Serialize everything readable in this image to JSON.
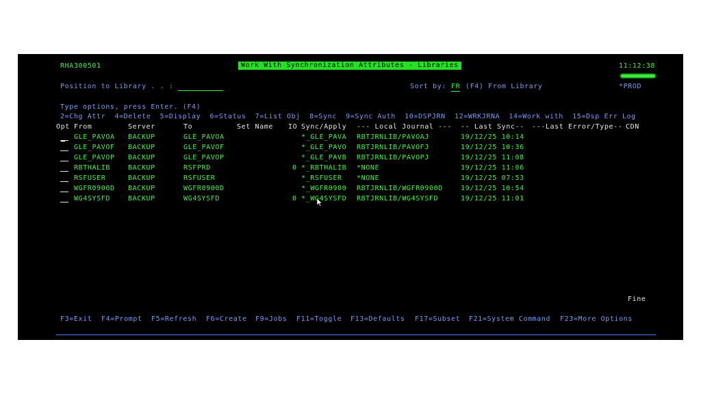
{
  "header": {
    "program": "RHA300501",
    "title": "Work With Synchronization Attributes - Libraries",
    "time": "11:12:38",
    "environment": "*PROD"
  },
  "position": {
    "label": "Position to Library . . :",
    "value": ""
  },
  "sort": {
    "label": "Sort by:",
    "value": "FR",
    "suffix": "(F4) From Library"
  },
  "options": {
    "instruction": "Type options, press Enter. (F4)",
    "line": "2=Chg Attr  4=Delete  5=Display  6=Status  7=List Obj  8=Sync  9=Sync Auth  10=DSPJRN  12=WRKJRNA  14=Work with  15=Dsp Err Log"
  },
  "table": {
    "columns": [
      "Opt",
      "From",
      "Server",
      "To",
      "Set Name",
      "IO",
      "Sync/Apply",
      "--- Local Journal ---",
      "-- Last Sync--",
      "---Last Error/Type--",
      "CDN"
    ],
    "rows": [
      {
        "opt": "",
        "from": "GLE_PAVOA",
        "server": "BACKUP",
        "to": "GLE_PAVOA",
        "set": "",
        "io": "",
        "sync": "*_GLE_PAVA",
        "journal": "RBTJRNLIB/PAVOAJ",
        "last_sync": "19/12/25 10:14"
      },
      {
        "opt": "",
        "from": "GLE_PAVOF",
        "server": "BACKUP",
        "to": "GLE_PAVOF",
        "set": "",
        "io": "",
        "sync": "*_GLE_PAVO",
        "journal": "RBTJRNLIB/PAVOFJ",
        "last_sync": "19/12/25 10:36"
      },
      {
        "opt": "",
        "from": "GLE_PAVOP",
        "server": "BACKUP",
        "to": "GLE_PAVOP",
        "set": "",
        "io": "",
        "sync": "*_GLE_PAVB",
        "journal": "RBTJRNLIB/PAVOPJ",
        "last_sync": "19/12/25 11:08"
      },
      {
        "opt": "",
        "from": "RBTHALIB",
        "server": "BACKUP",
        "to": "RSFPRD",
        "set": "",
        "io": "0",
        "sync": "*_RBTHALIB",
        "journal": "*NONE",
        "last_sync": "19/12/25 11:06"
      },
      {
        "opt": "",
        "from": "RSFUSER",
        "server": "BACKUP",
        "to": "RSFUSER",
        "set": "",
        "io": "",
        "sync": "*_RSFUSER",
        "journal": "*NONE",
        "last_sync": "19/12/25 07:53"
      },
      {
        "opt": "",
        "from": "WGFR0900D",
        "server": "BACKUP",
        "to": "WGFR0900D",
        "set": "",
        "io": "",
        "sync": "*_WGFR0900",
        "journal": "RBTJRNLIB/WGFR0900D",
        "last_sync": "19/12/25 10:54"
      },
      {
        "opt": "",
        "from": "WG4SYSFD",
        "server": "BACKUP",
        "to": "WG4SYSFD",
        "set": "",
        "io": "0",
        "sync": "*_WG4SYSFD",
        "journal": "RBTJRNLIB/WG4SYSFD",
        "last_sync": "19/12/25 11:01"
      }
    ]
  },
  "footer": {
    "status": "Fine",
    "fkeys": [
      "F3=Exit",
      "F4=Prompt",
      "F5=Refresh",
      "F6=Create",
      "F9=Jobs",
      "F11=Toggle",
      "F13=Defaults",
      "F17=Subset",
      "F21=System Command",
      "F23=More Options"
    ]
  },
  "colors": {
    "green": "#3cf53c",
    "blue": "#7a9cf5",
    "white": "#e8e8e8",
    "background": "#000000"
  }
}
